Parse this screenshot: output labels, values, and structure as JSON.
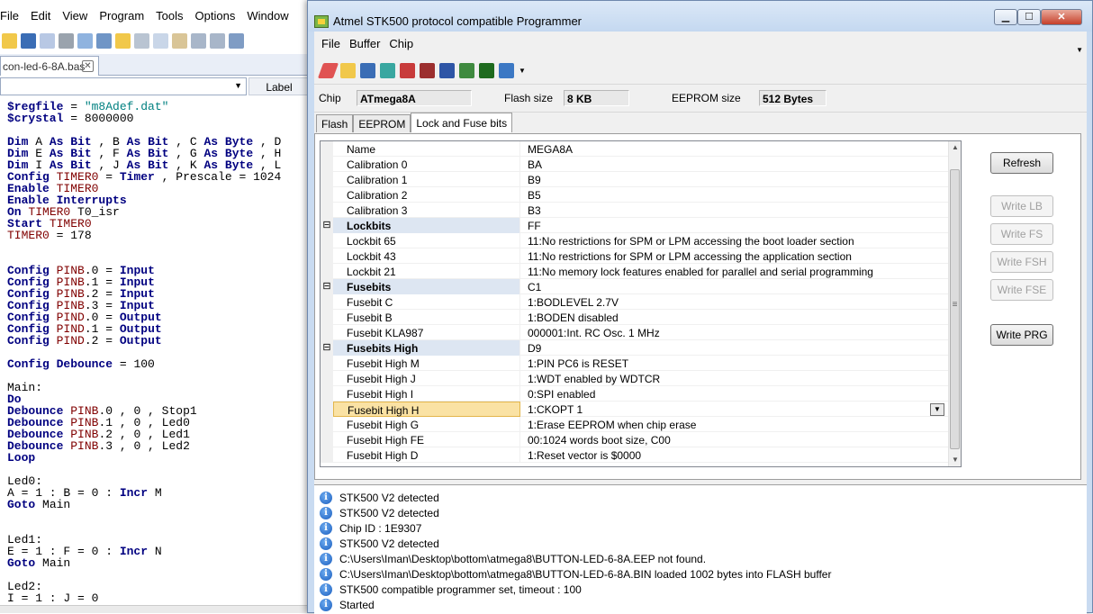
{
  "ide": {
    "menu": [
      "File",
      "Edit",
      "View",
      "Program",
      "Tools",
      "Options",
      "Window"
    ],
    "tab_label": "con-led-6-8A.bas",
    "label_header": "Label",
    "code": [
      [
        [
          "$regfile",
          "kw"
        ],
        [
          " = ",
          ""
        ],
        [
          "\"m8Adef.dat\"",
          "st"
        ]
      ],
      [
        [
          "$crystal",
          "kw"
        ],
        [
          " = 8000000",
          ""
        ]
      ],
      [
        [
          "",
          ""
        ]
      ],
      [
        [
          "Dim",
          "kw"
        ],
        [
          " A ",
          ""
        ],
        [
          "As",
          "kw"
        ],
        [
          " ",
          ""
        ],
        [
          "Bit",
          "kw"
        ],
        [
          " , B ",
          ""
        ],
        [
          "As",
          "kw"
        ],
        [
          " ",
          ""
        ],
        [
          "Bit",
          "kw"
        ],
        [
          " , C ",
          ""
        ],
        [
          "As",
          "kw"
        ],
        [
          " ",
          ""
        ],
        [
          "Byte",
          "kw"
        ],
        [
          " , D",
          ""
        ]
      ],
      [
        [
          "Dim",
          "kw"
        ],
        [
          " E ",
          ""
        ],
        [
          "As",
          "kw"
        ],
        [
          " ",
          ""
        ],
        [
          "Bit",
          "kw"
        ],
        [
          " , F ",
          ""
        ],
        [
          "As",
          "kw"
        ],
        [
          " ",
          ""
        ],
        [
          "Bit",
          "kw"
        ],
        [
          " , G ",
          ""
        ],
        [
          "As",
          "kw"
        ],
        [
          " ",
          ""
        ],
        [
          "Byte",
          "kw"
        ],
        [
          " , H",
          ""
        ]
      ],
      [
        [
          "Dim",
          "kw"
        ],
        [
          " I ",
          ""
        ],
        [
          "As",
          "kw"
        ],
        [
          " ",
          ""
        ],
        [
          "Bit",
          "kw"
        ],
        [
          " , J ",
          ""
        ],
        [
          "As",
          "kw"
        ],
        [
          " ",
          ""
        ],
        [
          "Bit",
          "kw"
        ],
        [
          " , K ",
          ""
        ],
        [
          "As",
          "kw"
        ],
        [
          " ",
          ""
        ],
        [
          "Byte",
          "kw"
        ],
        [
          " , L",
          ""
        ]
      ],
      [
        [
          "Config",
          "kw"
        ],
        [
          " ",
          ""
        ],
        [
          "TIMER0",
          "va"
        ],
        [
          " = ",
          ""
        ],
        [
          "Timer",
          "kw"
        ],
        [
          " , Prescale = 1024",
          ""
        ]
      ],
      [
        [
          "Enable",
          "kw"
        ],
        [
          " ",
          ""
        ],
        [
          "TIMER0",
          "va"
        ]
      ],
      [
        [
          "Enable",
          "kw"
        ],
        [
          " ",
          ""
        ],
        [
          "Interrupts",
          "kw"
        ]
      ],
      [
        [
          "On",
          "kw"
        ],
        [
          " ",
          ""
        ],
        [
          "TIMER0",
          "va"
        ],
        [
          " T0_isr",
          ""
        ]
      ],
      [
        [
          "Start",
          "kw"
        ],
        [
          " ",
          ""
        ],
        [
          "TIMER0",
          "va"
        ]
      ],
      [
        [
          "TIMER0",
          "va"
        ],
        [
          " = 178",
          ""
        ]
      ],
      [
        [
          "",
          ""
        ]
      ],
      [
        [
          "",
          ""
        ]
      ],
      [
        [
          "Config",
          "kw"
        ],
        [
          " ",
          ""
        ],
        [
          "PINB",
          "va"
        ],
        [
          ".0 = ",
          ""
        ],
        [
          "Input",
          "kw"
        ]
      ],
      [
        [
          "Config",
          "kw"
        ],
        [
          " ",
          ""
        ],
        [
          "PINB",
          "va"
        ],
        [
          ".1 = ",
          ""
        ],
        [
          "Input",
          "kw"
        ]
      ],
      [
        [
          "Config",
          "kw"
        ],
        [
          " ",
          ""
        ],
        [
          "PINB",
          "va"
        ],
        [
          ".2 = ",
          ""
        ],
        [
          "Input",
          "kw"
        ]
      ],
      [
        [
          "Config",
          "kw"
        ],
        [
          " ",
          ""
        ],
        [
          "PINB",
          "va"
        ],
        [
          ".3 = ",
          ""
        ],
        [
          "Input",
          "kw"
        ]
      ],
      [
        [
          "Config",
          "kw"
        ],
        [
          " ",
          ""
        ],
        [
          "PIND",
          "va"
        ],
        [
          ".0 = ",
          ""
        ],
        [
          "Output",
          "kw"
        ]
      ],
      [
        [
          "Config",
          "kw"
        ],
        [
          " ",
          ""
        ],
        [
          "PIND",
          "va"
        ],
        [
          ".1 = ",
          ""
        ],
        [
          "Output",
          "kw"
        ]
      ],
      [
        [
          "Config",
          "kw"
        ],
        [
          " ",
          ""
        ],
        [
          "PIND",
          "va"
        ],
        [
          ".2 = ",
          ""
        ],
        [
          "Output",
          "kw"
        ]
      ],
      [
        [
          "",
          ""
        ]
      ],
      [
        [
          "Config",
          "kw"
        ],
        [
          " ",
          ""
        ],
        [
          "Debounce",
          "kw"
        ],
        [
          " = 100",
          ""
        ]
      ],
      [
        [
          "",
          ""
        ]
      ],
      [
        [
          "Main:",
          ""
        ]
      ],
      [
        [
          "Do",
          "kw"
        ]
      ],
      [
        [
          "Debounce",
          "kw"
        ],
        [
          " ",
          ""
        ],
        [
          "PINB",
          "va"
        ],
        [
          ".0 , 0 , Stop1",
          ""
        ]
      ],
      [
        [
          "Debounce",
          "kw"
        ],
        [
          " ",
          ""
        ],
        [
          "PINB",
          "va"
        ],
        [
          ".1 , 0 , Led0",
          ""
        ]
      ],
      [
        [
          "Debounce",
          "kw"
        ],
        [
          " ",
          ""
        ],
        [
          "PINB",
          "va"
        ],
        [
          ".2 , 0 , Led1",
          ""
        ]
      ],
      [
        [
          "Debounce",
          "kw"
        ],
        [
          " ",
          ""
        ],
        [
          "PINB",
          "va"
        ],
        [
          ".3 , 0 , Led2",
          ""
        ]
      ],
      [
        [
          "Loop",
          "kw"
        ]
      ],
      [
        [
          "",
          ""
        ]
      ],
      [
        [
          "Led0:",
          ""
        ]
      ],
      [
        [
          "A = 1 : B = 0 : ",
          ""
        ],
        [
          "Incr",
          "kw"
        ],
        [
          " M",
          ""
        ]
      ],
      [
        [
          "Goto",
          "kw"
        ],
        [
          " Main",
          ""
        ]
      ],
      [
        [
          "",
          ""
        ]
      ],
      [
        [
          "",
          ""
        ]
      ],
      [
        [
          "Led1:",
          ""
        ]
      ],
      [
        [
          "E = 1 : F = 0 : ",
          ""
        ],
        [
          "Incr",
          "kw"
        ],
        [
          " N",
          ""
        ]
      ],
      [
        [
          "Goto",
          "kw"
        ],
        [
          " Main",
          ""
        ]
      ],
      [
        [
          "",
          ""
        ]
      ],
      [
        [
          "Led2:",
          ""
        ]
      ],
      [
        [
          "I = 1 : J = 0",
          ""
        ]
      ]
    ]
  },
  "programmer": {
    "title": "Atmel STK500 protocol compatible Programmer",
    "menu": [
      "File",
      "Buffer",
      "Chip"
    ],
    "chip_label": "Chip",
    "chip_value": "ATmega8A",
    "flash_label": "Flash size",
    "flash_value": "8 KB",
    "eeprom_label": "EEPROM size",
    "eeprom_value": "512 Bytes",
    "tabs": [
      "Flash",
      "EEPROM",
      "Lock and Fuse bits"
    ],
    "grid_rows": [
      {
        "name": "Name",
        "value": "MEGA8A",
        "type": "item"
      },
      {
        "name": "Calibration 0",
        "value": "BA",
        "type": "item"
      },
      {
        "name": "Calibration 1",
        "value": "B9",
        "type": "item"
      },
      {
        "name": "Calibration 2",
        "value": "B5",
        "type": "item"
      },
      {
        "name": "Calibration 3",
        "value": "B3",
        "type": "item"
      },
      {
        "name": "Lockbits",
        "value": "FF",
        "type": "cat"
      },
      {
        "name": "Lockbit 65",
        "value": "11:No restrictions for SPM or LPM accessing the boot loader section",
        "type": "item"
      },
      {
        "name": "Lockbit 43",
        "value": "11:No restrictions for SPM or LPM accessing the application section",
        "type": "item"
      },
      {
        "name": "Lockbit 21",
        "value": "11:No memory lock features enabled for parallel and serial programming",
        "type": "item"
      },
      {
        "name": "Fusebits",
        "value": "C1",
        "type": "cat"
      },
      {
        "name": "Fusebit C",
        "value": "1:BODLEVEL 2.7V",
        "type": "item"
      },
      {
        "name": "Fusebit B",
        "value": "1:BODEN disabled",
        "type": "item"
      },
      {
        "name": "Fusebit KLA987",
        "value": "000001:Int. RC Osc. 1 MHz",
        "type": "item"
      },
      {
        "name": "Fusebits High",
        "value": "D9",
        "type": "cat"
      },
      {
        "name": "Fusebit High M",
        "value": "1:PIN PC6 is RESET",
        "type": "item"
      },
      {
        "name": "Fusebit High J",
        "value": "1:WDT enabled by WDTCR",
        "type": "item"
      },
      {
        "name": "Fusebit High I",
        "value": "0:SPI enabled",
        "type": "item"
      },
      {
        "name": "Fusebit High H",
        "value": "1:CKOPT 1",
        "type": "sel"
      },
      {
        "name": "Fusebit High G",
        "value": "1:Erase EEPROM when chip erase",
        "type": "item"
      },
      {
        "name": "Fusebit High FE",
        "value": "00:1024 words boot size, C00",
        "type": "item"
      },
      {
        "name": "Fusebit High D",
        "value": "1:Reset vector is $0000",
        "type": "item"
      }
    ],
    "buttons": {
      "refresh": "Refresh",
      "write_lb": "Write LB",
      "write_fs": "Write FS",
      "write_fsh": "Write FSH",
      "write_fse": "Write FSE",
      "write_prg": "Write PRG"
    },
    "log": [
      "STK500 V2 detected",
      "STK500 V2 detected",
      "Chip ID : 1E9307",
      "STK500 V2 detected",
      "C:\\Users\\Iman\\Desktop\\bottom\\atmega8\\BUTTON-LED-6-8A.EEP not found.",
      "C:\\Users\\Iman\\Desktop\\bottom\\atmega8\\BUTTON-LED-6-8A.BIN loaded 1002 bytes into FLASH buffer",
      "STK500 compatible programmer set, timeout : 100",
      "Started"
    ]
  }
}
